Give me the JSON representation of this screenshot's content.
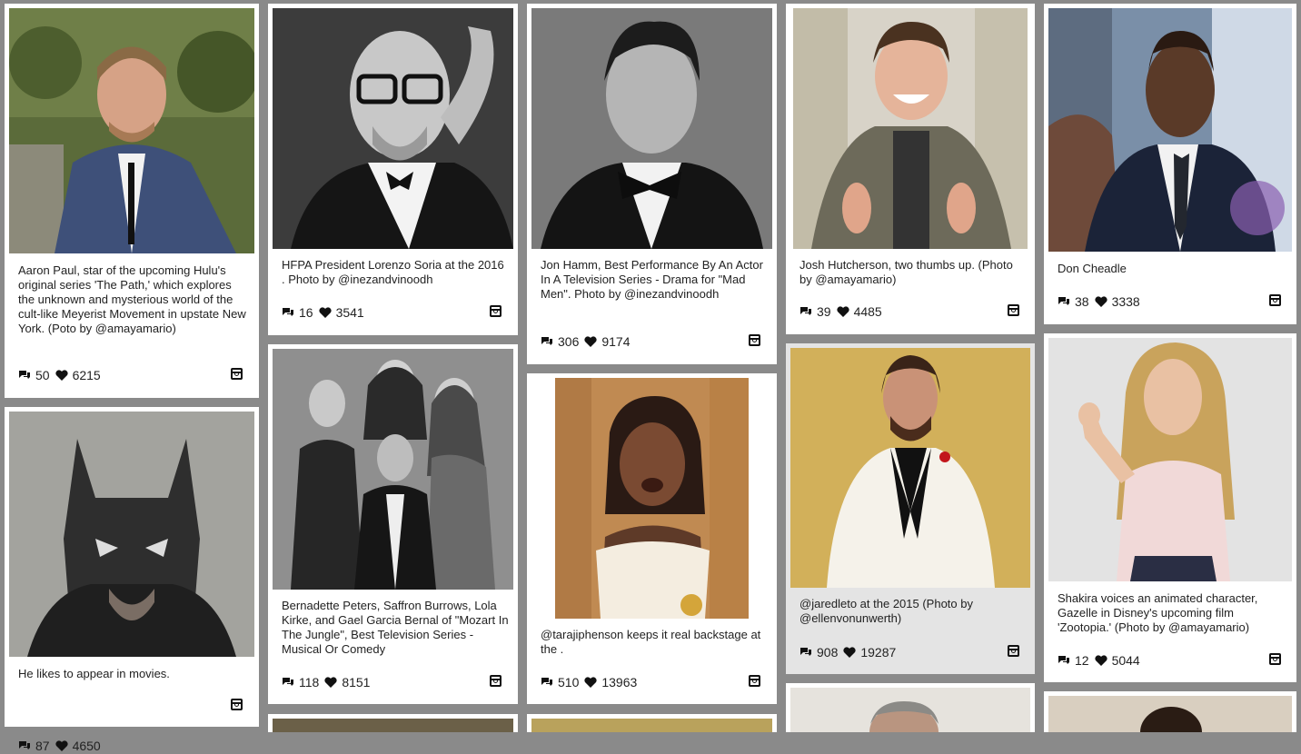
{
  "posts": [
    {
      "caption": "Aaron Paul, star of the upcoming Hulu's original series 'The Path,' which explores the unknown and mysterious world of the cult-like Meyerist Movement in upstate New York. (Poto by @amayamario)",
      "comments": "50",
      "likes": "6215"
    },
    {
      "caption": "He likes to appear in movies.",
      "comments": "87",
      "likes": "4650"
    },
    {
      "caption": "HFPA President Lorenzo Soria at the 2016 . Photo by @inezandvinoodh",
      "comments": "16",
      "likes": "3541"
    },
    {
      "caption": "Bernadette Peters, Saffron Burrows, Lola Kirke, and Gael Garcia Bernal of \"Mozart In The Jungle\", Best Television Series - Musical Or Comedy",
      "comments": "118",
      "likes": "8151"
    },
    {
      "caption": "Jon Hamm, Best Performance By An Actor In A Television Series - Drama for \"Mad Men\". Photo by @inezandvinoodh",
      "comments": "306",
      "likes": "9174"
    },
    {
      "caption": "@tarajiphenson keeps it real backstage at the .",
      "comments": "510",
      "likes": "13963"
    },
    {
      "caption": "Josh Hutcherson, two thumbs up. (Photo by @amayamario)",
      "comments": "39",
      "likes": "4485"
    },
    {
      "caption": "@jaredleto at the 2015 (Photo by @ellenvonunwerth)",
      "comments": "908",
      "likes": "19287"
    },
    {
      "caption": "Don Cheadle",
      "comments": "38",
      "likes": "3338"
    },
    {
      "caption": "Shakira voices an animated character, Gazelle in Disney's upcoming film 'Zootopia.' (Photo by @amayamario)",
      "comments": "12",
      "likes": "5044"
    }
  ],
  "colors": {
    "page_bg": "#8a8a8a",
    "card_bg": "#ffffff",
    "highlight_bg": "#e4e4e4"
  },
  "icons": {
    "comment": "speech-bubble-icon",
    "like": "heart-icon",
    "source": "instagram-icon"
  }
}
